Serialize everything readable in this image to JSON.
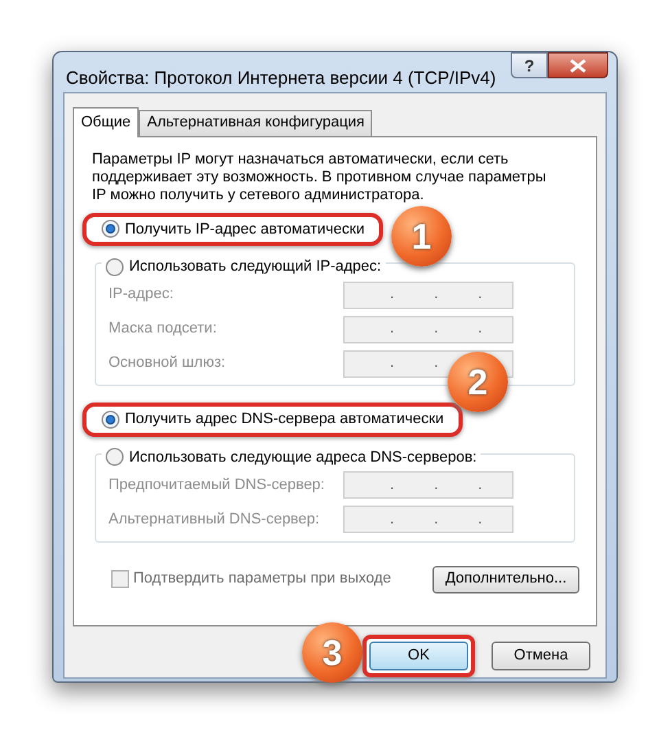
{
  "window": {
    "title": "Свойства: Протокол Интернета версии 4 (TCP/IPv4)",
    "help_button": "?"
  },
  "tabs": [
    {
      "label": "Общие",
      "selected": true
    },
    {
      "label": "Альтернативная конфигурация",
      "selected": false
    }
  ],
  "description": "Параметры IP могут назначаться автоматически, если сеть поддерживает эту возможность. В противном случае параметры IP можно получить у сетевого администратора.",
  "sections": [
    {
      "options": [
        {
          "label": "Получить IP-адрес автоматически",
          "selected": true,
          "highlighted": true
        },
        {
          "label": "Использовать следующий IP-адрес:",
          "selected": false,
          "highlighted": false
        }
      ],
      "fields": [
        {
          "label": "IP-адрес:",
          "disabled": true,
          "separators": [
            ".",
            ".",
            "."
          ]
        },
        {
          "label": "Маска подсети:",
          "disabled": true,
          "separators": [
            ".",
            ".",
            "."
          ]
        },
        {
          "label": "Основной шлюз:",
          "disabled": true,
          "separators": [
            ".",
            "."
          ]
        }
      ]
    },
    {
      "options": [
        {
          "label": "Получить адрес DNS-сервера автоматически",
          "selected": true,
          "highlighted": true
        },
        {
          "label": "Использовать следующие адреса DNS-серверов:",
          "selected": false,
          "highlighted": false
        }
      ],
      "fields": [
        {
          "label": "Предпочитаемый DNS-сервер:",
          "disabled": true,
          "separators": [
            ".",
            ".",
            "."
          ]
        },
        {
          "label": "Альтернативный DNS-сервер:",
          "disabled": true,
          "separators": [
            ".",
            ".",
            "."
          ]
        }
      ]
    }
  ],
  "validate": {
    "label": "Подтвердить параметры при выходе",
    "checked": false,
    "disabled": true
  },
  "advanced_button": "Дополнительно...",
  "buttons": [
    {
      "label": "OK",
      "highlighted": true,
      "default": true
    },
    {
      "label": "Отмена",
      "highlighted": false,
      "default": false
    }
  ],
  "callouts": [
    "1",
    "2",
    "3"
  ]
}
